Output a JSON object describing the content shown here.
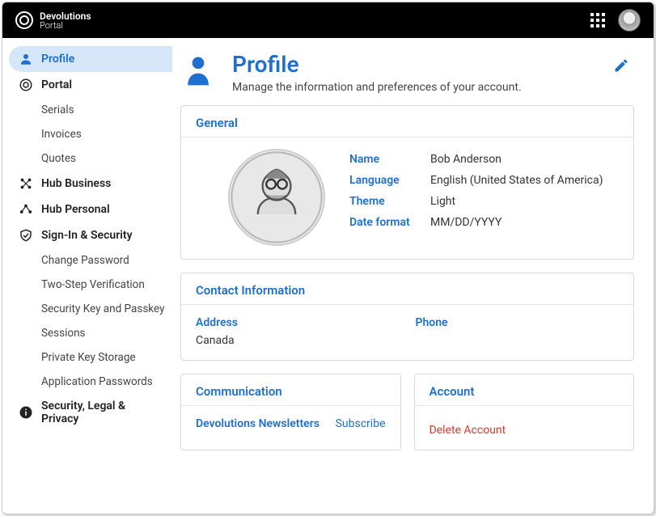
{
  "brand": {
    "line1": "Devolutions",
    "line2": "Portal"
  },
  "sidebar": {
    "items": [
      {
        "label": "Profile"
      },
      {
        "label": "Portal"
      },
      {
        "label": "Serials"
      },
      {
        "label": "Invoices"
      },
      {
        "label": "Quotes"
      },
      {
        "label": "Hub Business"
      },
      {
        "label": "Hub Personal"
      },
      {
        "label": "Sign-In & Security"
      },
      {
        "label": "Change Password"
      },
      {
        "label": "Two-Step Verification"
      },
      {
        "label": "Security Key and Passkey"
      },
      {
        "label": "Sessions"
      },
      {
        "label": "Private Key Storage"
      },
      {
        "label": "Application Passwords"
      },
      {
        "label": "Security, Legal & Privacy"
      }
    ]
  },
  "page": {
    "title": "Profile",
    "subtitle": "Manage the information and preferences of your account."
  },
  "general": {
    "title": "General",
    "name_label": "Name",
    "name": "Bob Anderson",
    "language_label": "Language",
    "language": "English (United States of America)",
    "theme_label": "Theme",
    "theme": "Light",
    "dateformat_label": "Date format",
    "dateformat": "MM/DD/YYYY"
  },
  "contact": {
    "title": "Contact Information",
    "address_label": "Address",
    "address": "Canada",
    "phone_label": "Phone",
    "phone": ""
  },
  "communication": {
    "title": "Communication",
    "newsletters_label": "Devolutions Newsletters",
    "subscribe": "Subscribe"
  },
  "account": {
    "title": "Account",
    "delete": "Delete Account"
  }
}
